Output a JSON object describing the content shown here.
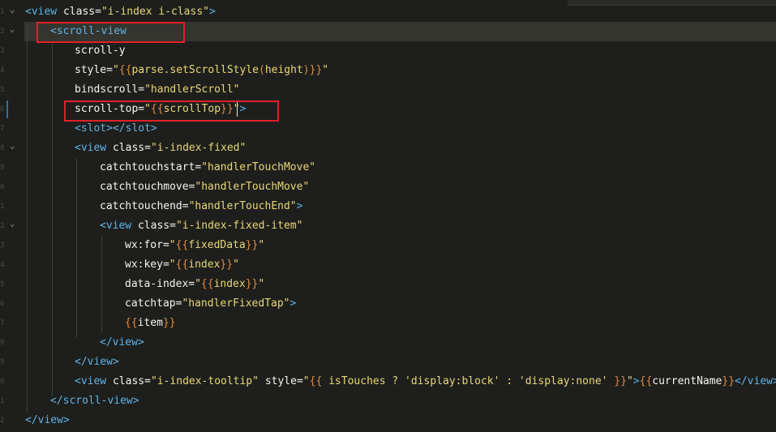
{
  "code_lines": [
    {
      "segments": [
        {
          "t": "<view",
          "c": "tag"
        },
        {
          "t": " class=",
          "c": "attr"
        },
        {
          "t": "\"i-index i-class\"",
          "c": "str"
        },
        {
          "t": ">",
          "c": "tag"
        }
      ]
    },
    {
      "segments": [
        {
          "t": "<scroll-view",
          "c": "tag"
        }
      ]
    },
    {
      "segments": [
        {
          "t": "scroll-y",
          "c": "attr"
        }
      ]
    },
    {
      "segments": [
        {
          "t": "style=",
          "c": "attr"
        },
        {
          "t": "\"",
          "c": "str"
        },
        {
          "t": "{{",
          "c": "br"
        },
        {
          "t": "parse.setScrollStyle",
          "c": "str"
        },
        {
          "t": "(",
          "c": "br"
        },
        {
          "t": "height",
          "c": "str"
        },
        {
          "t": ")",
          "c": "br"
        },
        {
          "t": "}}",
          "c": "br"
        },
        {
          "t": "\"",
          "c": "str"
        }
      ]
    },
    {
      "segments": [
        {
          "t": "bindscroll=",
          "c": "attr"
        },
        {
          "t": "\"handlerScroll\"",
          "c": "str"
        }
      ]
    },
    {
      "segments": [
        {
          "t": "scroll-top=",
          "c": "attr"
        },
        {
          "t": "\"",
          "c": "str"
        },
        {
          "t": "{{",
          "c": "br"
        },
        {
          "t": "scrollTop",
          "c": "str"
        },
        {
          "t": "}}",
          "c": "br"
        },
        {
          "t": "\"",
          "c": "str"
        },
        {
          "t": ">",
          "c": "tag"
        }
      ]
    },
    {
      "segments": [
        {
          "t": "<slot></slot>",
          "c": "tag"
        }
      ]
    },
    {
      "segments": [
        {
          "t": "<view",
          "c": "tag"
        },
        {
          "t": " class=",
          "c": "attr"
        },
        {
          "t": "\"i-index-fixed\"",
          "c": "str"
        }
      ]
    },
    {
      "segments": [
        {
          "t": "catchtouchstart=",
          "c": "attr"
        },
        {
          "t": "\"handlerTouchMove\"",
          "c": "str"
        }
      ]
    },
    {
      "segments": [
        {
          "t": "catchtouchmove=",
          "c": "attr"
        },
        {
          "t": "\"handlerTouchMove\"",
          "c": "str"
        }
      ]
    },
    {
      "segments": [
        {
          "t": "catchtouchend=",
          "c": "attr"
        },
        {
          "t": "\"handlerTouchEnd\"",
          "c": "str"
        },
        {
          "t": ">",
          "c": "tag"
        }
      ]
    },
    {
      "segments": [
        {
          "t": "<view",
          "c": "tag"
        },
        {
          "t": " class=",
          "c": "attr"
        },
        {
          "t": "\"i-index-fixed-item\"",
          "c": "str"
        }
      ]
    },
    {
      "segments": [
        {
          "t": "wx:for=",
          "c": "attr"
        },
        {
          "t": "\"",
          "c": "str"
        },
        {
          "t": "{{",
          "c": "br"
        },
        {
          "t": "fixedData",
          "c": "str"
        },
        {
          "t": "}}",
          "c": "br"
        },
        {
          "t": "\"",
          "c": "str"
        }
      ]
    },
    {
      "segments": [
        {
          "t": "wx:key=",
          "c": "attr"
        },
        {
          "t": "\"",
          "c": "str"
        },
        {
          "t": "{{",
          "c": "br"
        },
        {
          "t": "index",
          "c": "str"
        },
        {
          "t": "}}",
          "c": "br"
        },
        {
          "t": "\"",
          "c": "str"
        }
      ]
    },
    {
      "segments": [
        {
          "t": "data-index=",
          "c": "attr"
        },
        {
          "t": "\"",
          "c": "str"
        },
        {
          "t": "{{",
          "c": "br"
        },
        {
          "t": "index",
          "c": "str"
        },
        {
          "t": "}}",
          "c": "br"
        },
        {
          "t": "\"",
          "c": "str"
        }
      ]
    },
    {
      "segments": [
        {
          "t": "catchtap=",
          "c": "attr"
        },
        {
          "t": "\"handlerFixedTap\"",
          "c": "str"
        },
        {
          "t": ">",
          "c": "tag"
        }
      ]
    },
    {
      "segments": [
        {
          "t": "{{",
          "c": "br"
        },
        {
          "t": "item",
          "c": "plain"
        },
        {
          "t": "}}",
          "c": "br"
        }
      ]
    },
    {
      "segments": [
        {
          "t": "</view>",
          "c": "tag"
        }
      ]
    },
    {
      "segments": [
        {
          "t": "</view>",
          "c": "tag"
        }
      ]
    },
    {
      "segments": [
        {
          "t": "<view",
          "c": "tag"
        },
        {
          "t": " class=",
          "c": "attr"
        },
        {
          "t": "\"i-index-tooltip\"",
          "c": "str"
        },
        {
          "t": " style=",
          "c": "attr"
        },
        {
          "t": "\"",
          "c": "str"
        },
        {
          "t": "{{",
          "c": "br"
        },
        {
          "t": " isTouches ? 'display:block' : 'display:none' ",
          "c": "str"
        },
        {
          "t": "}}",
          "c": "br"
        },
        {
          "t": "\"",
          "c": "str"
        },
        {
          "t": ">",
          "c": "tag"
        },
        {
          "t": "{{",
          "c": "br"
        },
        {
          "t": "currentName",
          "c": "plain"
        },
        {
          "t": "}}",
          "c": "br"
        },
        {
          "t": "</view>",
          "c": "tag"
        }
      ]
    },
    {
      "segments": [
        {
          "t": "</scroll-view>",
          "c": "tag"
        }
      ]
    },
    {
      "segments": [
        {
          "t": "</view>",
          "c": "tag"
        }
      ]
    }
  ],
  "gutter_numbers": [
    "1",
    "2",
    "3",
    "4",
    "5",
    "6",
    "7",
    "8",
    "9",
    "0",
    "1",
    "2",
    "3",
    "4",
    "5",
    "6",
    "7",
    "8",
    "9",
    "0",
    "1",
    "2"
  ],
  "fold_markers": [
    "chevron-down",
    "chevron-down",
    "",
    "",
    "",
    "",
    "",
    "chevron-down",
    "",
    "",
    "",
    "chevron-down",
    "",
    "",
    "",
    "",
    "",
    "",
    "",
    "",
    "",
    ""
  ],
  "fold_glyph": "⌄",
  "colors": {
    "background": "#1e1f1c",
    "tag": "#5fb3e8",
    "string": "#e8d77a",
    "bracket": "#e08a3b",
    "attribute": "#f4f4f0",
    "highlight_box": "#e0202a"
  }
}
